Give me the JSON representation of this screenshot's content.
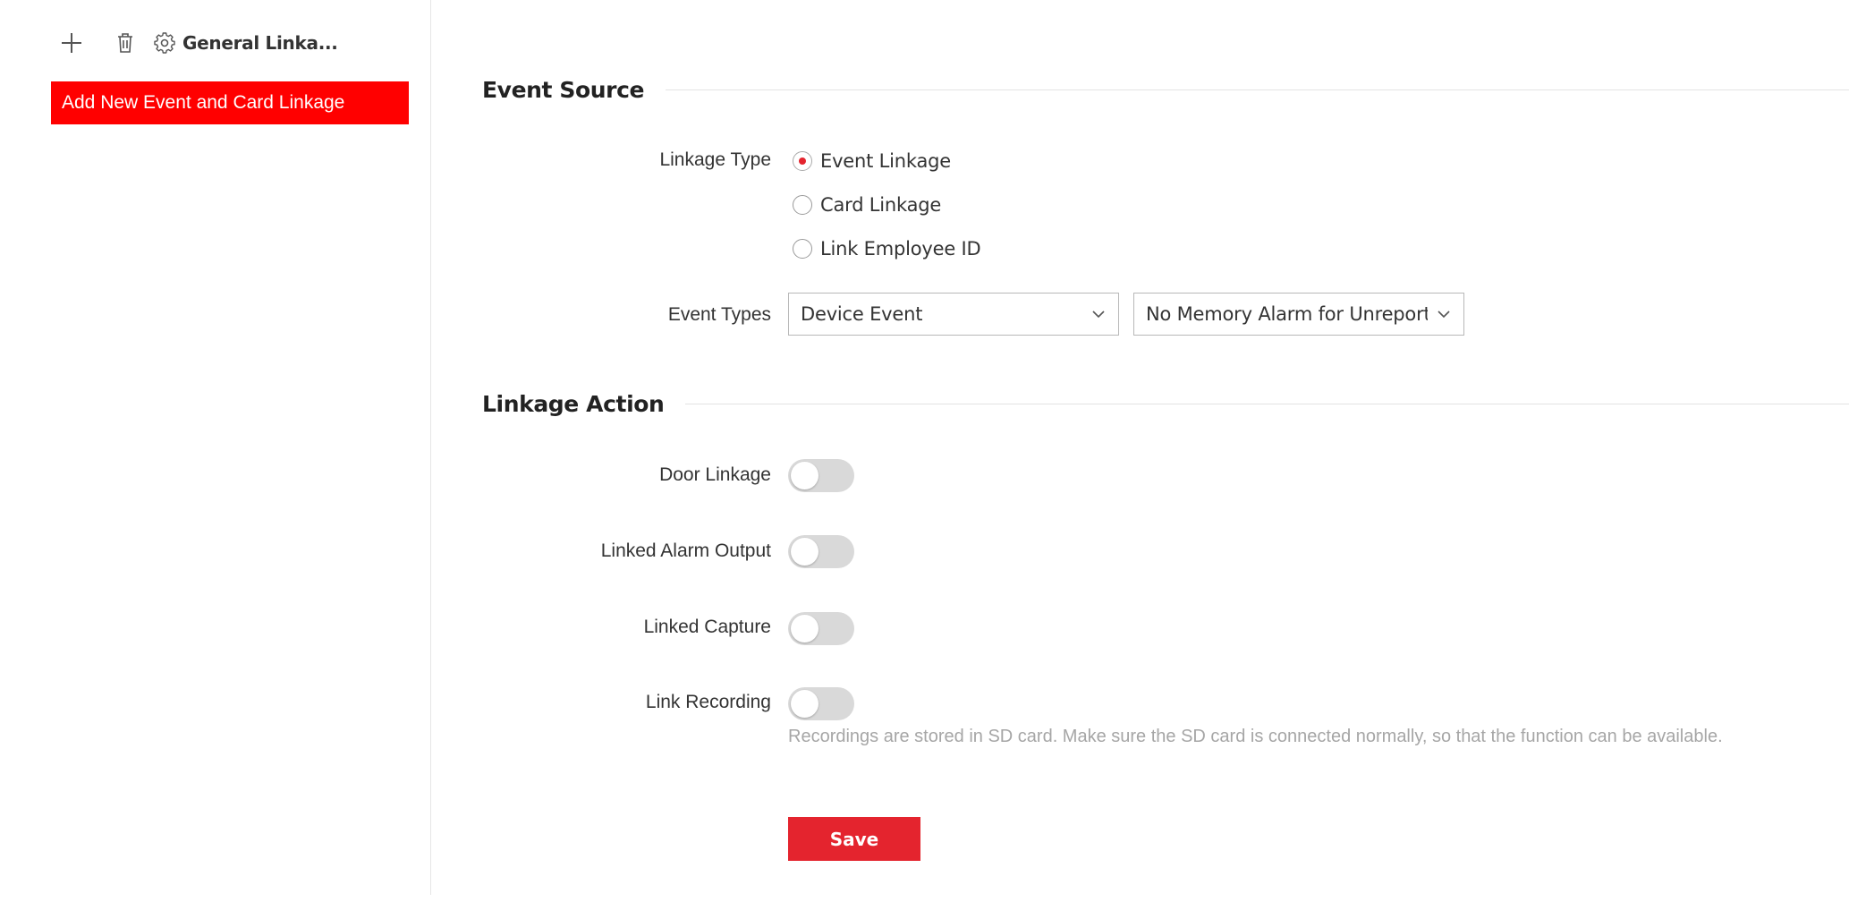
{
  "colors": {
    "accent": "#e4242e",
    "selected_item_bg": "#ff0000",
    "toggle_off": "#d9d9d9",
    "hint_text": "#a6a6a6"
  },
  "sidebar": {
    "toolbar": {
      "add_icon": "plus-icon",
      "delete_icon": "trash-icon",
      "settings_icon": "gear-icon",
      "general_label": "General Linka..."
    },
    "items": [
      {
        "label": "Add New Event and Card Linkage",
        "selected": true
      }
    ]
  },
  "event_source": {
    "title": "Event Source",
    "linkage_type": {
      "label": "Linkage Type",
      "options": [
        {
          "label": "Event Linkage",
          "checked": true
        },
        {
          "label": "Card Linkage",
          "checked": false
        },
        {
          "label": "Link Employee ID",
          "checked": false
        }
      ]
    },
    "event_types": {
      "label": "Event Types",
      "category": "Device Event",
      "event": "No Memory Alarm for Unreported"
    }
  },
  "linkage_action": {
    "title": "Linkage Action",
    "toggles": [
      {
        "label": "Door Linkage",
        "on": false
      },
      {
        "label": "Linked Alarm Output",
        "on": false
      },
      {
        "label": "Linked Capture",
        "on": false
      },
      {
        "label": "Link Recording",
        "on": false
      }
    ],
    "recording_hint": "Recordings are stored in SD card. Make sure the SD card is connected normally, so that the function can be available."
  },
  "save_label": "Save"
}
